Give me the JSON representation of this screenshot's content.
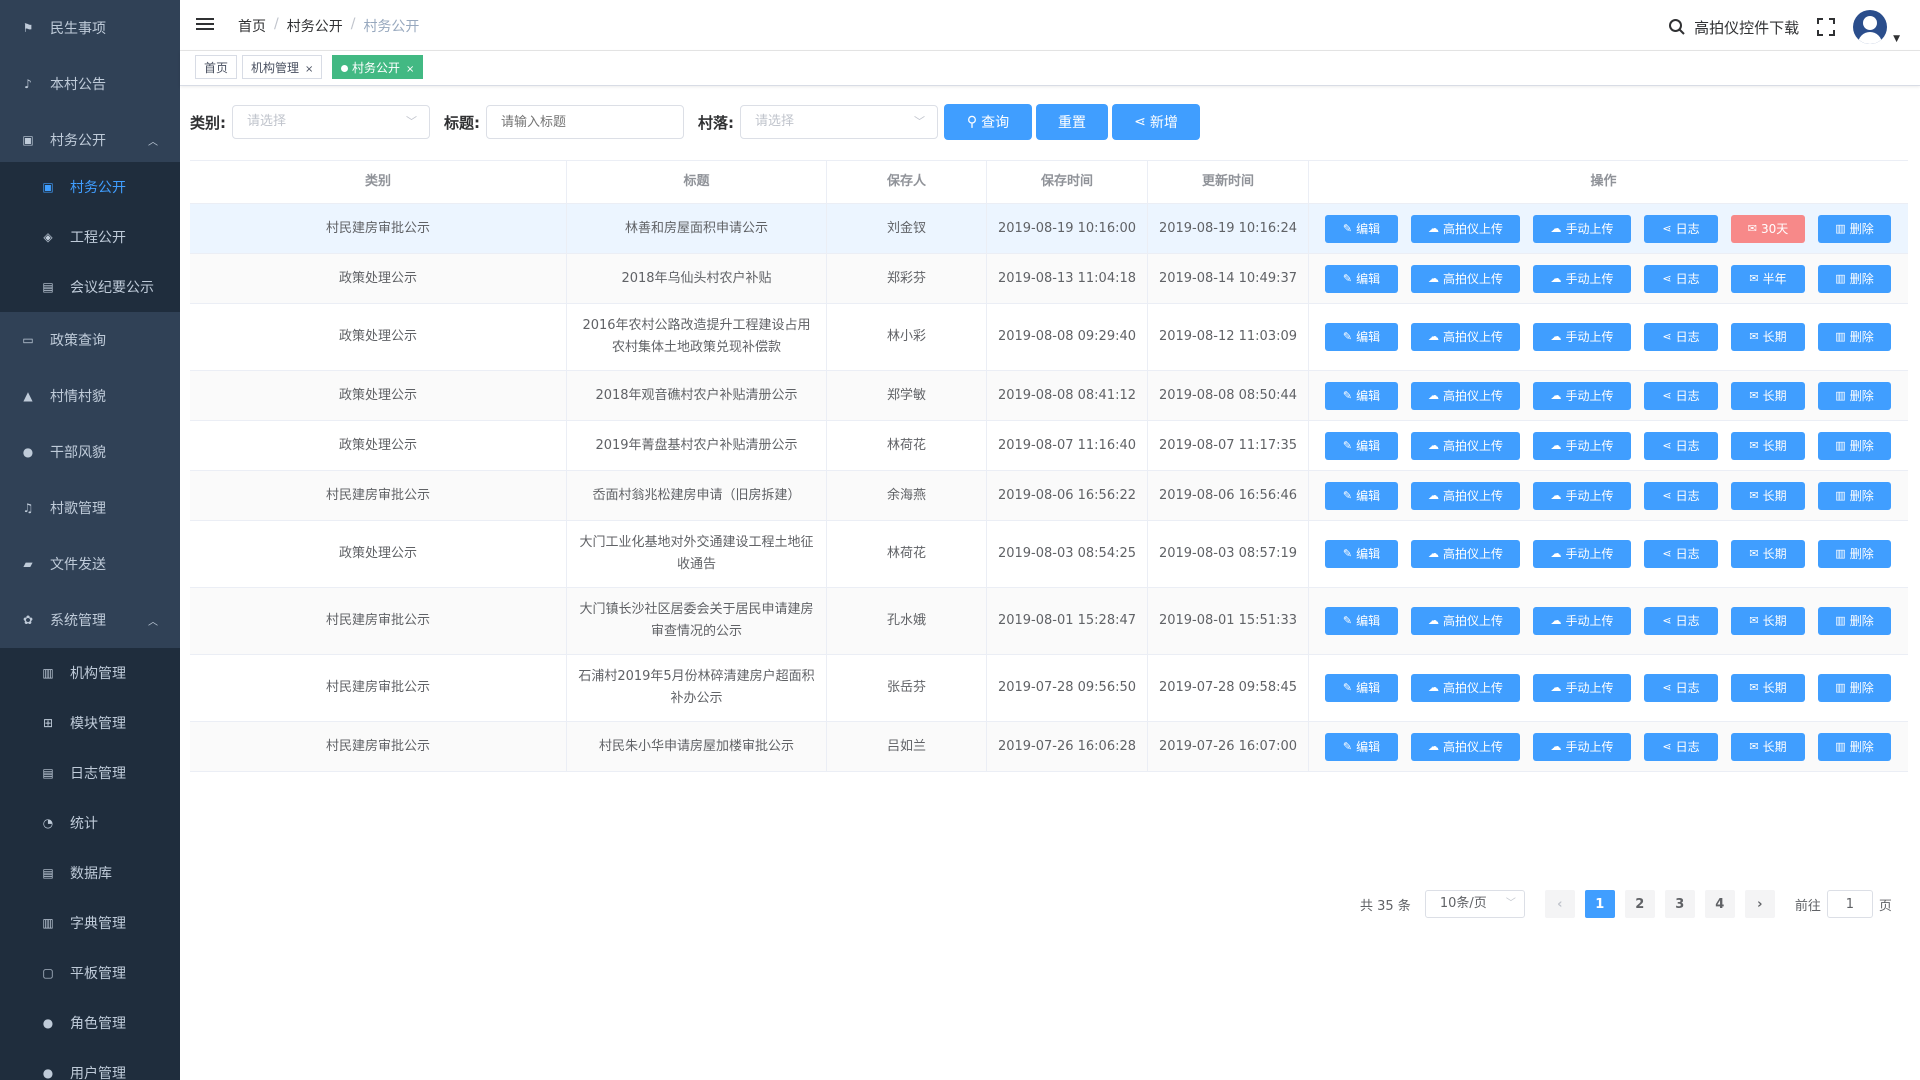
{
  "sidebar": {
    "items": [
      {
        "label": "民生事项",
        "icon": "bookmark-icon"
      },
      {
        "label": "本村公告",
        "icon": "bell-icon"
      },
      {
        "label": "村务公开",
        "icon": "calendar-icon",
        "expanded": true
      },
      {
        "label": "村务公开",
        "icon": "calendar-icon",
        "sub": true,
        "active": true
      },
      {
        "label": "工程公开",
        "icon": "layers-icon",
        "sub": true
      },
      {
        "label": "会议纪要公示",
        "icon": "document-icon",
        "sub": true
      },
      {
        "label": "政策查询",
        "icon": "id-card-icon"
      },
      {
        "label": "村情村貌",
        "icon": "mountain-icon"
      },
      {
        "label": "干部风貌",
        "icon": "user-icon"
      },
      {
        "label": "村歌管理",
        "icon": "music-icon"
      },
      {
        "label": "文件发送",
        "icon": "folder-icon"
      },
      {
        "label": "系统管理",
        "icon": "gear-icon",
        "expanded": true
      },
      {
        "label": "机构管理",
        "icon": "building-icon",
        "sub": true
      },
      {
        "label": "模块管理",
        "icon": "sitemap-icon",
        "sub": true
      },
      {
        "label": "日志管理",
        "icon": "log-icon",
        "sub": true
      },
      {
        "label": "统计",
        "icon": "pie-chart-icon",
        "sub": true
      },
      {
        "label": "数据库",
        "icon": "database-icon",
        "sub": true
      },
      {
        "label": "字典管理",
        "icon": "book-icon",
        "sub": true
      },
      {
        "label": "平板管理",
        "icon": "tablet-icon",
        "sub": true
      },
      {
        "label": "角色管理",
        "icon": "user-role-icon",
        "sub": true
      },
      {
        "label": "用户管理",
        "icon": "users-icon",
        "sub": true
      }
    ]
  },
  "breadcrumb": {
    "home": "首页",
    "section": "村务公开",
    "current": "村务公开"
  },
  "topbar": {
    "download_label": "高拍仪控件下载"
  },
  "tags": [
    {
      "label": "首页"
    },
    {
      "label": "机构管理",
      "closable": true
    },
    {
      "label": "村务公开",
      "closable": true,
      "active": true
    }
  ],
  "filter": {
    "category_label": "类别:",
    "category_placeholder": "请选择",
    "title_label": "标题:",
    "title_placeholder": "请输入标题",
    "village_label": "村落:",
    "village_placeholder": "请选择",
    "search_label": "查询",
    "reset_label": "重置",
    "add_label": "新增"
  },
  "table": {
    "headers": [
      "类别",
      "标题",
      "保存人",
      "保存时间",
      "更新时间",
      "操作"
    ],
    "actions": {
      "edit": "编辑",
      "camera_upload": "高拍仪上传",
      "manual_upload": "手动上传",
      "log": "日志",
      "delete": "删除"
    },
    "rows": [
      {
        "category": "村民建房审批公示",
        "title": "林善和房屋面积申请公示",
        "saver": "刘金钗",
        "saved": "2019-08-19 10:16:00",
        "updated": "2019-08-19 10:16:24",
        "period": "30天",
        "period_warn": true
      },
      {
        "category": "政策处理公示",
        "title": "2018年乌仙头村农户补贴",
        "saver": "郑彩芬",
        "saved": "2019-08-13 11:04:18",
        "updated": "2019-08-14 10:49:37",
        "period": "半年"
      },
      {
        "category": "政策处理公示",
        "title": "2016年农村公路改造提升工程建设占用农村集体土地政策兑现补偿款",
        "saver": "林小彩",
        "saved": "2019-08-08 09:29:40",
        "updated": "2019-08-12 11:03:09",
        "period": "长期",
        "tall": true
      },
      {
        "category": "政策处理公示",
        "title": "2018年观音礁村农户补贴清册公示",
        "saver": "郑学敏",
        "saved": "2019-08-08 08:41:12",
        "updated": "2019-08-08 08:50:44",
        "period": "长期"
      },
      {
        "category": "政策处理公示",
        "title": "2019年菁盘基村农户补贴清册公示",
        "saver": "林荷花",
        "saved": "2019-08-07 11:16:40",
        "updated": "2019-08-07 11:17:35",
        "period": "长期"
      },
      {
        "category": "村民建房审批公示",
        "title": "岙面村翁兆松建房申请（旧房拆建）",
        "saver": "余海燕",
        "saved": "2019-08-06 16:56:22",
        "updated": "2019-08-06 16:56:46",
        "period": "长期"
      },
      {
        "category": "政策处理公示",
        "title": "大门工业化基地对外交通建设工程土地征收通告",
        "saver": "林荷花",
        "saved": "2019-08-03 08:54:25",
        "updated": "2019-08-03 08:57:19",
        "period": "长期",
        "tall": true
      },
      {
        "category": "村民建房审批公示",
        "title": "大门镇长沙社区居委会关于居民申请建房审查情况的公示",
        "saver": "孔水娥",
        "saved": "2019-08-01 15:28:47",
        "updated": "2019-08-01 15:51:33",
        "period": "长期",
        "tall": true
      },
      {
        "category": "村民建房审批公示",
        "title": "石浦村2019年5月份林碎清建房户超面积补办公示",
        "saver": "张岳芬",
        "saved": "2019-07-28 09:56:50",
        "updated": "2019-07-28 09:58:45",
        "period": "长期",
        "tall": true
      },
      {
        "category": "村民建房审批公示",
        "title": "村民朱小华申请房屋加楼审批公示",
        "saver": "吕如兰",
        "saved": "2019-07-26 16:06:28",
        "updated": "2019-07-26 16:07:00",
        "period": "长期"
      }
    ]
  },
  "pagination": {
    "total_text": "共 35 条",
    "page_size": "10条/页",
    "pages": [
      "1",
      "2",
      "3",
      "4"
    ],
    "current": "1",
    "goto_label": "前往",
    "goto_value": "1",
    "page_suffix": "页"
  }
}
